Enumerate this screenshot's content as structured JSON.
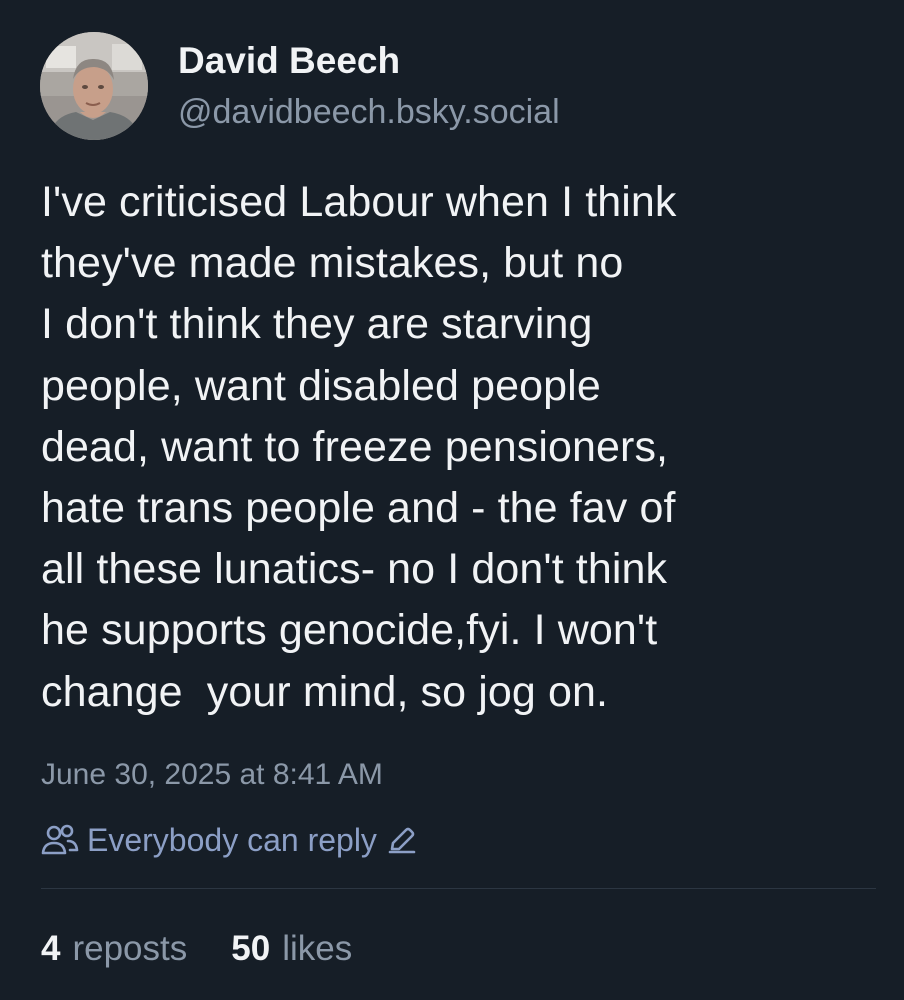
{
  "author": {
    "display_name": "David Beech",
    "handle": "@davidbeech.bsky.social"
  },
  "post": {
    "lines": [
      "I've criticised Labour when I think",
      "they've made mistakes, but no",
      "I don't think they are starving",
      "people, want disabled people",
      "dead, want to freeze pensioners,",
      "hate trans people and - the fav of",
      "all these lunatics- no I don't think",
      "he supports genocide,fyi. I won't",
      "change  your mind, so jog on."
    ],
    "timestamp": "June 30, 2025 at 8:41 AM",
    "reply_setting": "Everybody can reply"
  },
  "stats": {
    "reposts_count": "4",
    "reposts_label": "reposts",
    "likes_count": "50",
    "likes_label": "likes"
  },
  "icons": {
    "people": "people-icon",
    "edit": "pencil-icon"
  },
  "colors": {
    "background": "#161e27",
    "text_primary": "#f1f3f5",
    "text_secondary": "#8b98a8",
    "accent": "#8c9fc6",
    "divider": "#2c3642"
  }
}
